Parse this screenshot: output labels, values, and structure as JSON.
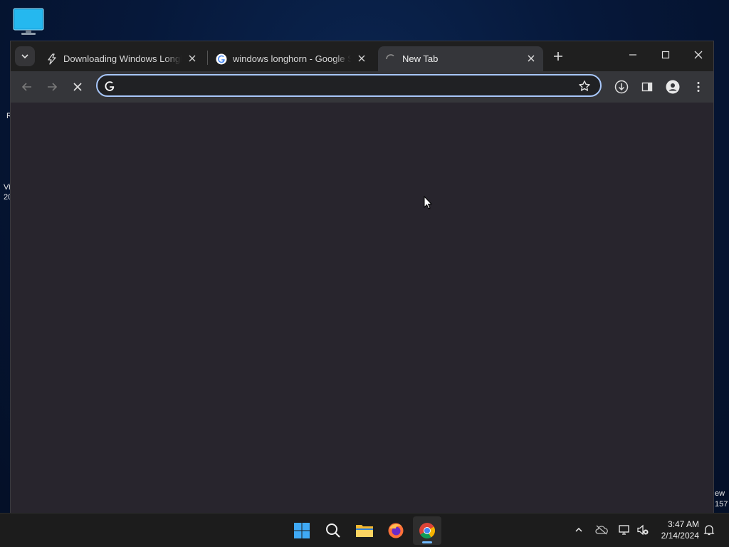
{
  "desktop": {
    "icon": "monitor-icon",
    "left_fragments": [
      "R",
      "Vi",
      "20"
    ],
    "right_fragments": [
      "ew",
      "157"
    ]
  },
  "browser": {
    "tabs": [
      {
        "title": "Downloading Windows Longhorn",
        "icon": "bolt-icon",
        "active": false
      },
      {
        "title": "windows longhorn - Google Search",
        "icon": "google-icon",
        "active": false
      },
      {
        "title": "New Tab",
        "icon": "loading-spinner-icon",
        "active": true
      }
    ],
    "omnibox": {
      "value": "",
      "placeholder": ""
    },
    "accent": "#a8c7fa",
    "background": "#28252d"
  },
  "taskbar": {
    "apps": [
      {
        "name": "Start",
        "icon": "windows-logo-icon"
      },
      {
        "name": "Search",
        "icon": "search-icon"
      },
      {
        "name": "File Explorer",
        "icon": "folder-icon"
      },
      {
        "name": "Firefox",
        "icon": "firefox-icon"
      },
      {
        "name": "Chrome",
        "icon": "chrome-icon",
        "active": true
      }
    ],
    "time": "3:47 AM",
    "date": "2/14/2024"
  }
}
